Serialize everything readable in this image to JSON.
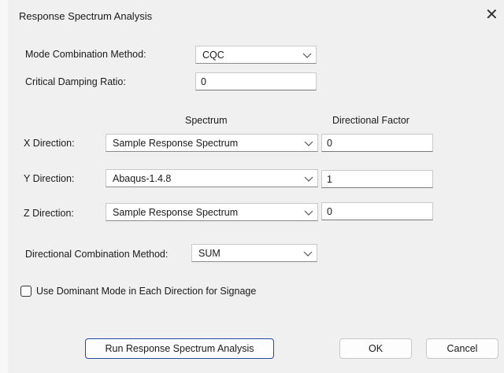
{
  "window": {
    "title": "Response Spectrum Analysis",
    "close_glyph": "✕"
  },
  "mode_combination": {
    "label": "Mode Combination Method:",
    "value": "CQC"
  },
  "critical_damping": {
    "label": "Critical Damping Ratio:",
    "value": "0"
  },
  "headers": {
    "spectrum": "Spectrum",
    "directional_factor": "Directional Factor"
  },
  "directions": [
    {
      "label": "X Direction:",
      "spectrum": "Sample Response Spectrum",
      "factor": "0"
    },
    {
      "label": "Y Direction:",
      "spectrum": "Abaqus-1.4.8",
      "factor": "1"
    },
    {
      "label": "Z Direction:",
      "spectrum": "Sample Response Spectrum",
      "factor": "0"
    }
  ],
  "directional_combination": {
    "label": "Directional Combination Method:",
    "value": "SUM"
  },
  "dominant_mode": {
    "label": "Use Dominant Mode in Each Direction for Signage",
    "checked": false
  },
  "buttons": {
    "run": "Run Response Spectrum Analysis",
    "ok": "OK",
    "cancel": "Cancel"
  },
  "colors": {
    "background": "#f0f0f0",
    "primary_border": "#1f4e9e"
  }
}
